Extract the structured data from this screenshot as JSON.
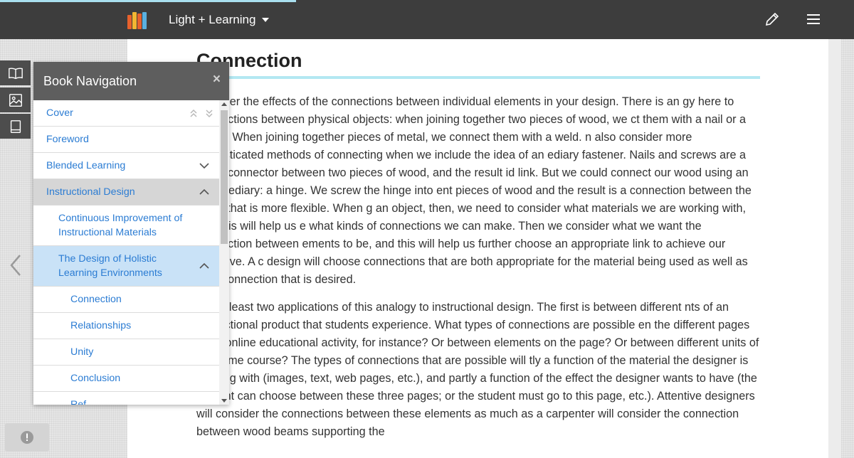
{
  "app": {
    "title": "Light + Learning",
    "logo_icon": "books-logo-icon",
    "colors": {
      "topbar": "#3d3d3d",
      "link": "#2b7cd3",
      "heading_underline": "#b3e8f2"
    }
  },
  "topbar_icons": [
    "pencil-icon",
    "hamburger-menu-icon"
  ],
  "rail_icons": [
    "open-book-icon",
    "image-icon",
    "notebook-icon"
  ],
  "nav": {
    "title": "Book Navigation",
    "close_symbol": "×",
    "items": [
      {
        "label": "Cover"
      },
      {
        "label": "Foreword"
      },
      {
        "label": "Blended Learning"
      },
      {
        "label": "Instructional Design"
      },
      {
        "label": "Continuous Improvement of Instructional Materials"
      },
      {
        "label": "The Design of Holistic Learning Environments"
      },
      {
        "label": "Connection"
      },
      {
        "label": "Relationships"
      },
      {
        "label": "Unity"
      },
      {
        "label": "Conclusion"
      },
      {
        "label": "Ref"
      }
    ]
  },
  "article": {
    "heading": "Connection",
    "paragraphs": [
      "consider the effects of the connections between individual elements in your design. There is an gy here to connections between physical objects: when joining together two pieces of wood, we ct them with a nail or a screw. When joining together pieces of metal, we connect them with a weld. n also consider more sophisticated methods of connecting when we include the idea of an ediary fastener. Nails and screws are a direct connector between two pieces of wood, and the result id link. But we could connect our wood using an intermediary: a hinge. We screw the hinge into ent pieces of wood and the result is a connection between the wood that is more flexible. When g an object, then, we need to consider what materials we are working with, and this will help us e what kinds of connections we can make. Then we consider what we want the connection between ements to be, and this will help us further choose an appropriate link to achieve our objective. A c design will choose connections that are both appropriate for the material being used as well as the f connection that is desired.",
      "are at least two applications of this analogy to instructional design. The first is between different nts of an instructional product that students experience. What types of connections are possible en the different pages of an online educational activity, for instance? Or between elements on the page? Or between different units of the same course? The types of connections that are possible will tly a function of the material the designer is working with (images, text, web pages, etc.), and partly a function of the effect the designer wants to have (the student can choose between these three pages; or the student must go to this page, etc.). Attentive designers will consider the connections between these elements as much as a carpenter will consider the connection between wood beams supporting the"
    ]
  },
  "feedback_icon": "exclamation-circle-icon"
}
